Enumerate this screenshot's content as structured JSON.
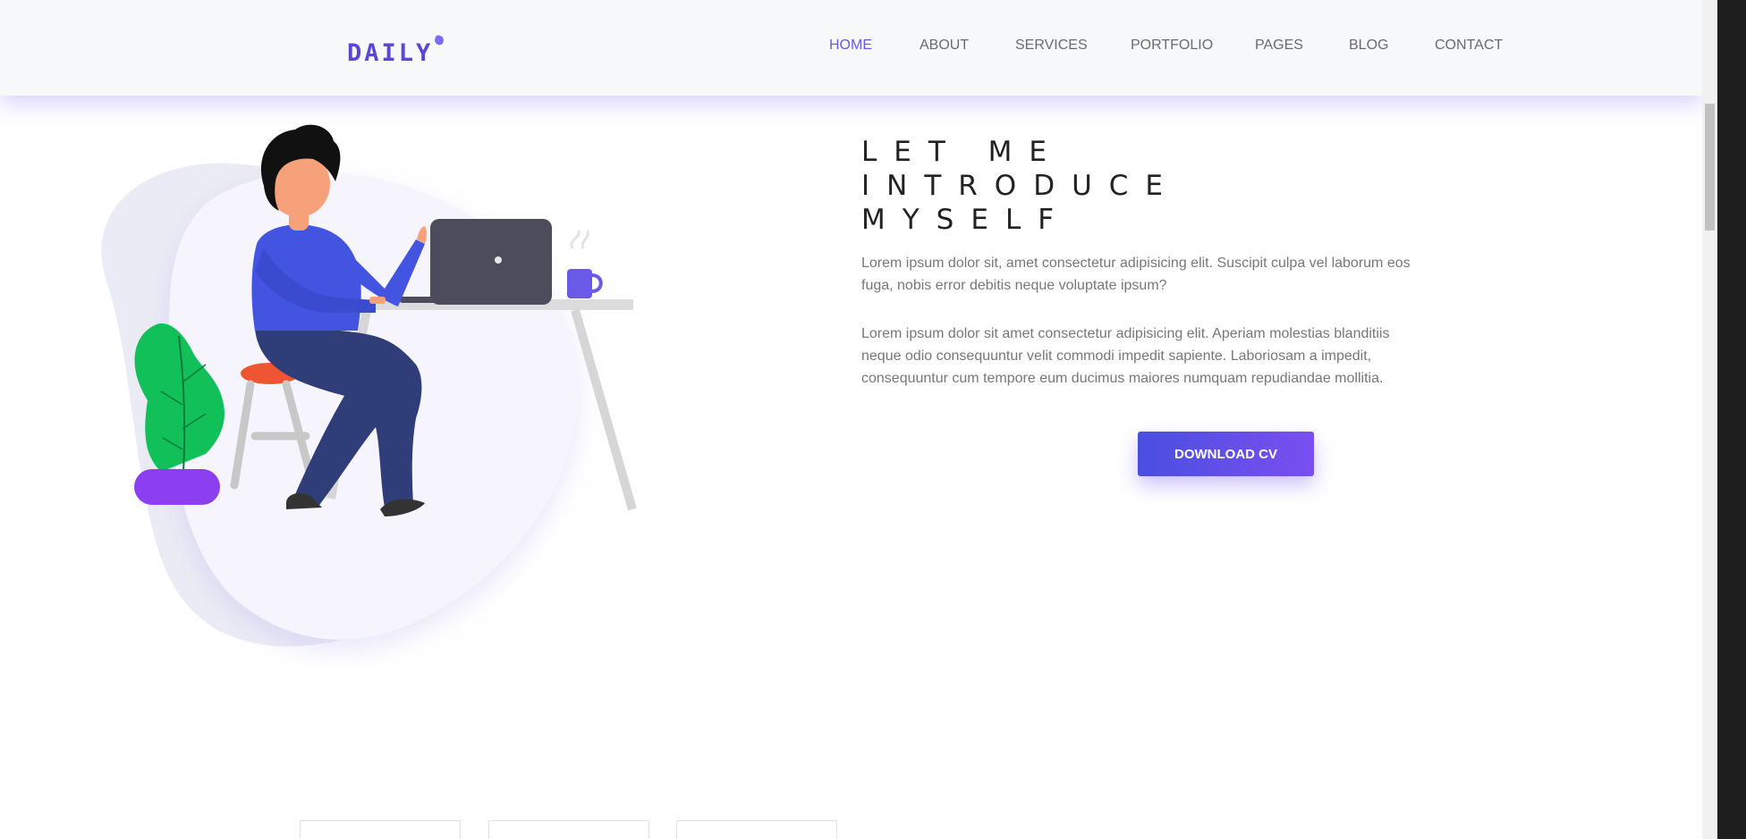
{
  "header": {
    "logo_text": "DAILY",
    "nav": [
      {
        "label": "HOME",
        "active": true
      },
      {
        "label": "ABOUT",
        "active": false
      },
      {
        "label": "SERVICES",
        "active": false
      },
      {
        "label": "PORTFOLIO",
        "active": false
      },
      {
        "label": "PAGES",
        "active": false
      },
      {
        "label": "BLOG",
        "active": false
      },
      {
        "label": "CONTACT",
        "active": false
      }
    ]
  },
  "hero": {
    "title_lines": [
      "LET ME",
      "INTRODUCE",
      "MYSELF"
    ],
    "paragraph_1": "Lorem ipsum dolor sit, amet consectetur adipisicing elit. Suscipit culpa vel laborum eos fuga, nobis error debitis neque voluptate ipsum?",
    "paragraph_2": "Lorem ipsum dolor sit amet consectetur adipisicing elit. Aperiam molestias blanditiis neque odio consequuntur velit commodi impedit sapiente. Laboriosam a impedit, consequuntur cum tempore eum ducimus maiores numquam repudiandae mollitia.",
    "download_label": "DOWNLOAD CV"
  },
  "colors": {
    "accent": "#6b5ae0",
    "button_gradient_start": "#4a4fe0",
    "button_gradient_end": "#7a4ff0"
  },
  "icons": {
    "logo_dot": "logo-dot-icon",
    "menu": "hamburger-menu-icon"
  }
}
